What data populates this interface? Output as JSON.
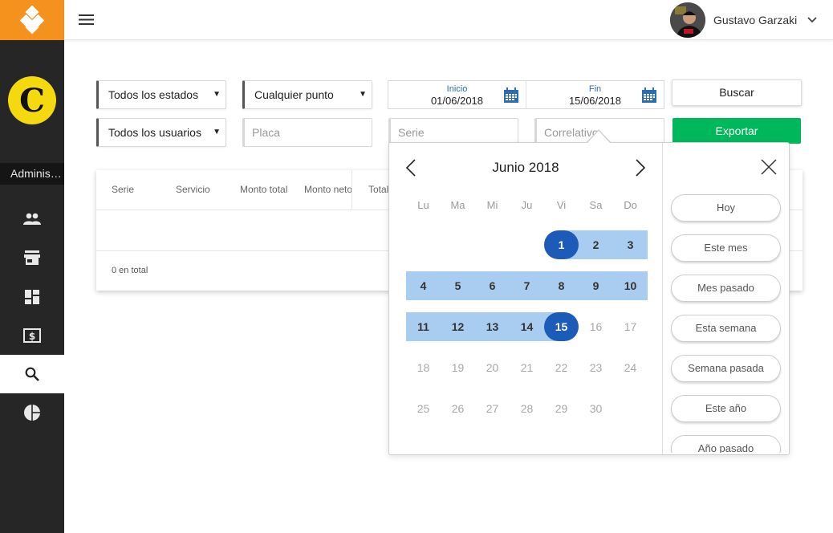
{
  "sidebar": {
    "brand_letter": "C",
    "role": "Administrador",
    "items": [
      {
        "icon": "group-icon"
      },
      {
        "icon": "store-icon"
      },
      {
        "icon": "dashboard-icon"
      },
      {
        "icon": "money-icon"
      },
      {
        "icon": "search-icon",
        "active": true
      },
      {
        "icon": "pie-chart-icon"
      }
    ]
  },
  "header": {
    "user_name": "Gustavo Garzaki"
  },
  "filters": {
    "status_select": "Todos los estados",
    "point_select": "Cualquier punto",
    "users_select": "Todos los usuarios",
    "plate_placeholder": "Placa",
    "series_placeholder": "Serie",
    "correlative_placeholder": "Correlativo",
    "date_start_label": "Inicio",
    "date_start_value": "01/06/2018",
    "date_end_label": "Fin",
    "date_end_value": "15/06/2018",
    "search_button": "Buscar",
    "export_button": "Exportar"
  },
  "table": {
    "columns": [
      "Serie",
      "Servicio",
      "Monto total",
      "Monto neto",
      "Total"
    ],
    "total_text": "0 en total"
  },
  "calendar": {
    "month_title": "Junio 2018",
    "weekdays": [
      "Lu",
      "Ma",
      "Mi",
      "Ju",
      "Vi",
      "Sa",
      "Do"
    ],
    "first_weekday_index": 4,
    "days_in_month": 30,
    "range_start": 1,
    "range_end": 15
  },
  "presets": [
    "Hoy",
    "Este mes",
    "Mes pasado",
    "Esta semana",
    "Semana pasada",
    "Este año",
    "Año pasado"
  ],
  "colors": {
    "accent_orange": "#f5921e",
    "range_fill": "#a8cdf0",
    "range_edge": "#1c5bb8",
    "export_green": "#00b85c"
  }
}
